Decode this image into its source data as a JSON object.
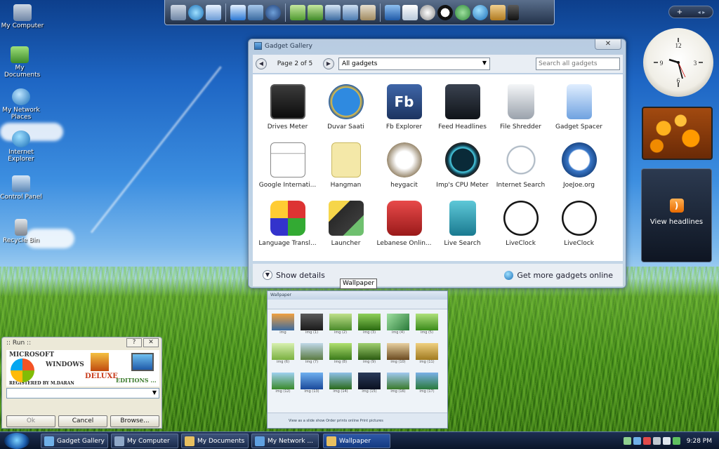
{
  "desktop": {
    "icons": [
      {
        "label": "My Computer",
        "icon": "computer-icon"
      },
      {
        "label": "My Documents",
        "icon": "documents-icon"
      },
      {
        "label": "My Network Places",
        "icon": "network-icon"
      },
      {
        "label": "Internet Explorer",
        "icon": "ie-icon"
      },
      {
        "label": "Control Panel",
        "icon": "control-panel-icon"
      },
      {
        "label": "Recycle Bin",
        "icon": "recycle-bin-icon"
      }
    ]
  },
  "sidebar": {
    "add_label": "+",
    "nav_label": "◂ ▸",
    "feed_label": "View headlines"
  },
  "gallery": {
    "title": "Gadget Gallery",
    "close_label": "✕",
    "page_label": "Page 2 of 5",
    "filter_value": "All gadgets",
    "search_placeholder": "Search all gadgets",
    "show_details": "Show details",
    "more_online": "Get more gadgets online",
    "gadgets": [
      {
        "name": "Drives Meter",
        "color": "#1a1a1a"
      },
      {
        "name": "Duvar Saati",
        "color": "#1f6fc4"
      },
      {
        "name": "Fb Explorer",
        "color": "#2d4f8c"
      },
      {
        "name": "Feed Headlines",
        "color": "#222831"
      },
      {
        "name": "File Shredder",
        "color": "#c9ccd1"
      },
      {
        "name": "Gadget Spacer",
        "color": "#7fb3e8"
      },
      {
        "name": "Google Internati...",
        "color": "#3a3a3a"
      },
      {
        "name": "Hangman",
        "color": "#f2e6a0"
      },
      {
        "name": "heygacit",
        "color": "#d9d2c4"
      },
      {
        "name": "Imp's CPU Meter",
        "color": "#0f3a4a"
      },
      {
        "name": "Internet Search",
        "color": "#cfd8e0"
      },
      {
        "name": "JoeJoe.org",
        "color": "#3a78c9"
      },
      {
        "name": "Language Transl...",
        "color": "#6aa04a"
      },
      {
        "name": "Launcher",
        "color": "#2a2a2a"
      },
      {
        "name": "Lebanese Onlin...",
        "color": "#c62a2a"
      },
      {
        "name": "Live Search",
        "color": "#2e9ab0"
      },
      {
        "name": "LiveClock",
        "color": "#111111"
      },
      {
        "name": "LiveClock",
        "color": "#111111"
      }
    ]
  },
  "tooltip": "Wallpaper",
  "wallpaper_window": {
    "title": "Wallpaper",
    "thumb_labels": [
      "img",
      "img (1)",
      "img (2)",
      "img (3)",
      "img (4)",
      "img (5)",
      "img (6)",
      "img (7)",
      "img (8)",
      "img (9)",
      "img (10)",
      "img (11)",
      "img (12)",
      "img (13)",
      "img (14)",
      "img (15)",
      "img (16)",
      "img (17)"
    ],
    "footer": "View as a slide show   Order prints online   Print pictures"
  },
  "run": {
    "title": ":: Run ::",
    "help_label": "?",
    "close_label": "✕",
    "banner": {
      "microsoft": "MICROSOFT",
      "windows": "WINDOWS",
      "deluxe": "DELUXE",
      "editions": "EDITIONS ...",
      "registered": "REGISTERED BY M.DARAN"
    },
    "ok": "Ok",
    "cancel": "Cancel",
    "browse": "Browse..."
  },
  "taskbar": {
    "buttons": [
      {
        "label": "Gadget Gallery",
        "color": "#6fb0e8"
      },
      {
        "label": "My Computer",
        "color": "#8fa8c8"
      },
      {
        "label": "My Documents",
        "color": "#e8c060"
      },
      {
        "label": "My Network ...",
        "color": "#5fa0e0"
      },
      {
        "label": "Wallpaper",
        "color": "#e8c060"
      }
    ],
    "time": "9:28 PM"
  },
  "colors": {
    "taskbar_bg": "#0a1529",
    "window_frame": "#c8d7e6",
    "accent": "#1f63b3"
  }
}
